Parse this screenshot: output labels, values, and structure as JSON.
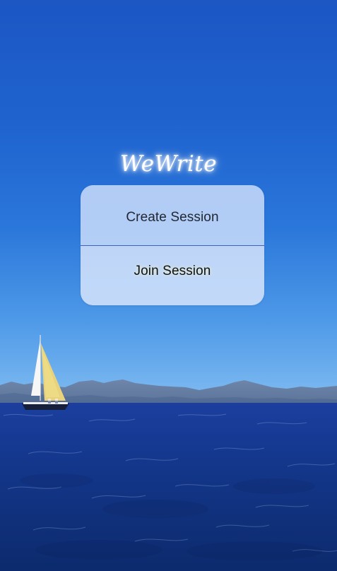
{
  "app": {
    "title": "WeWrite"
  },
  "menu": {
    "create_label": "Create Session",
    "join_label": "Join Session"
  },
  "colors": {
    "sky_top": "#1c57c4",
    "sky_horizon": "#86c0f2",
    "sea": "#163a94",
    "card_fill": "#e2ecff",
    "divider": "#3f63ba"
  }
}
